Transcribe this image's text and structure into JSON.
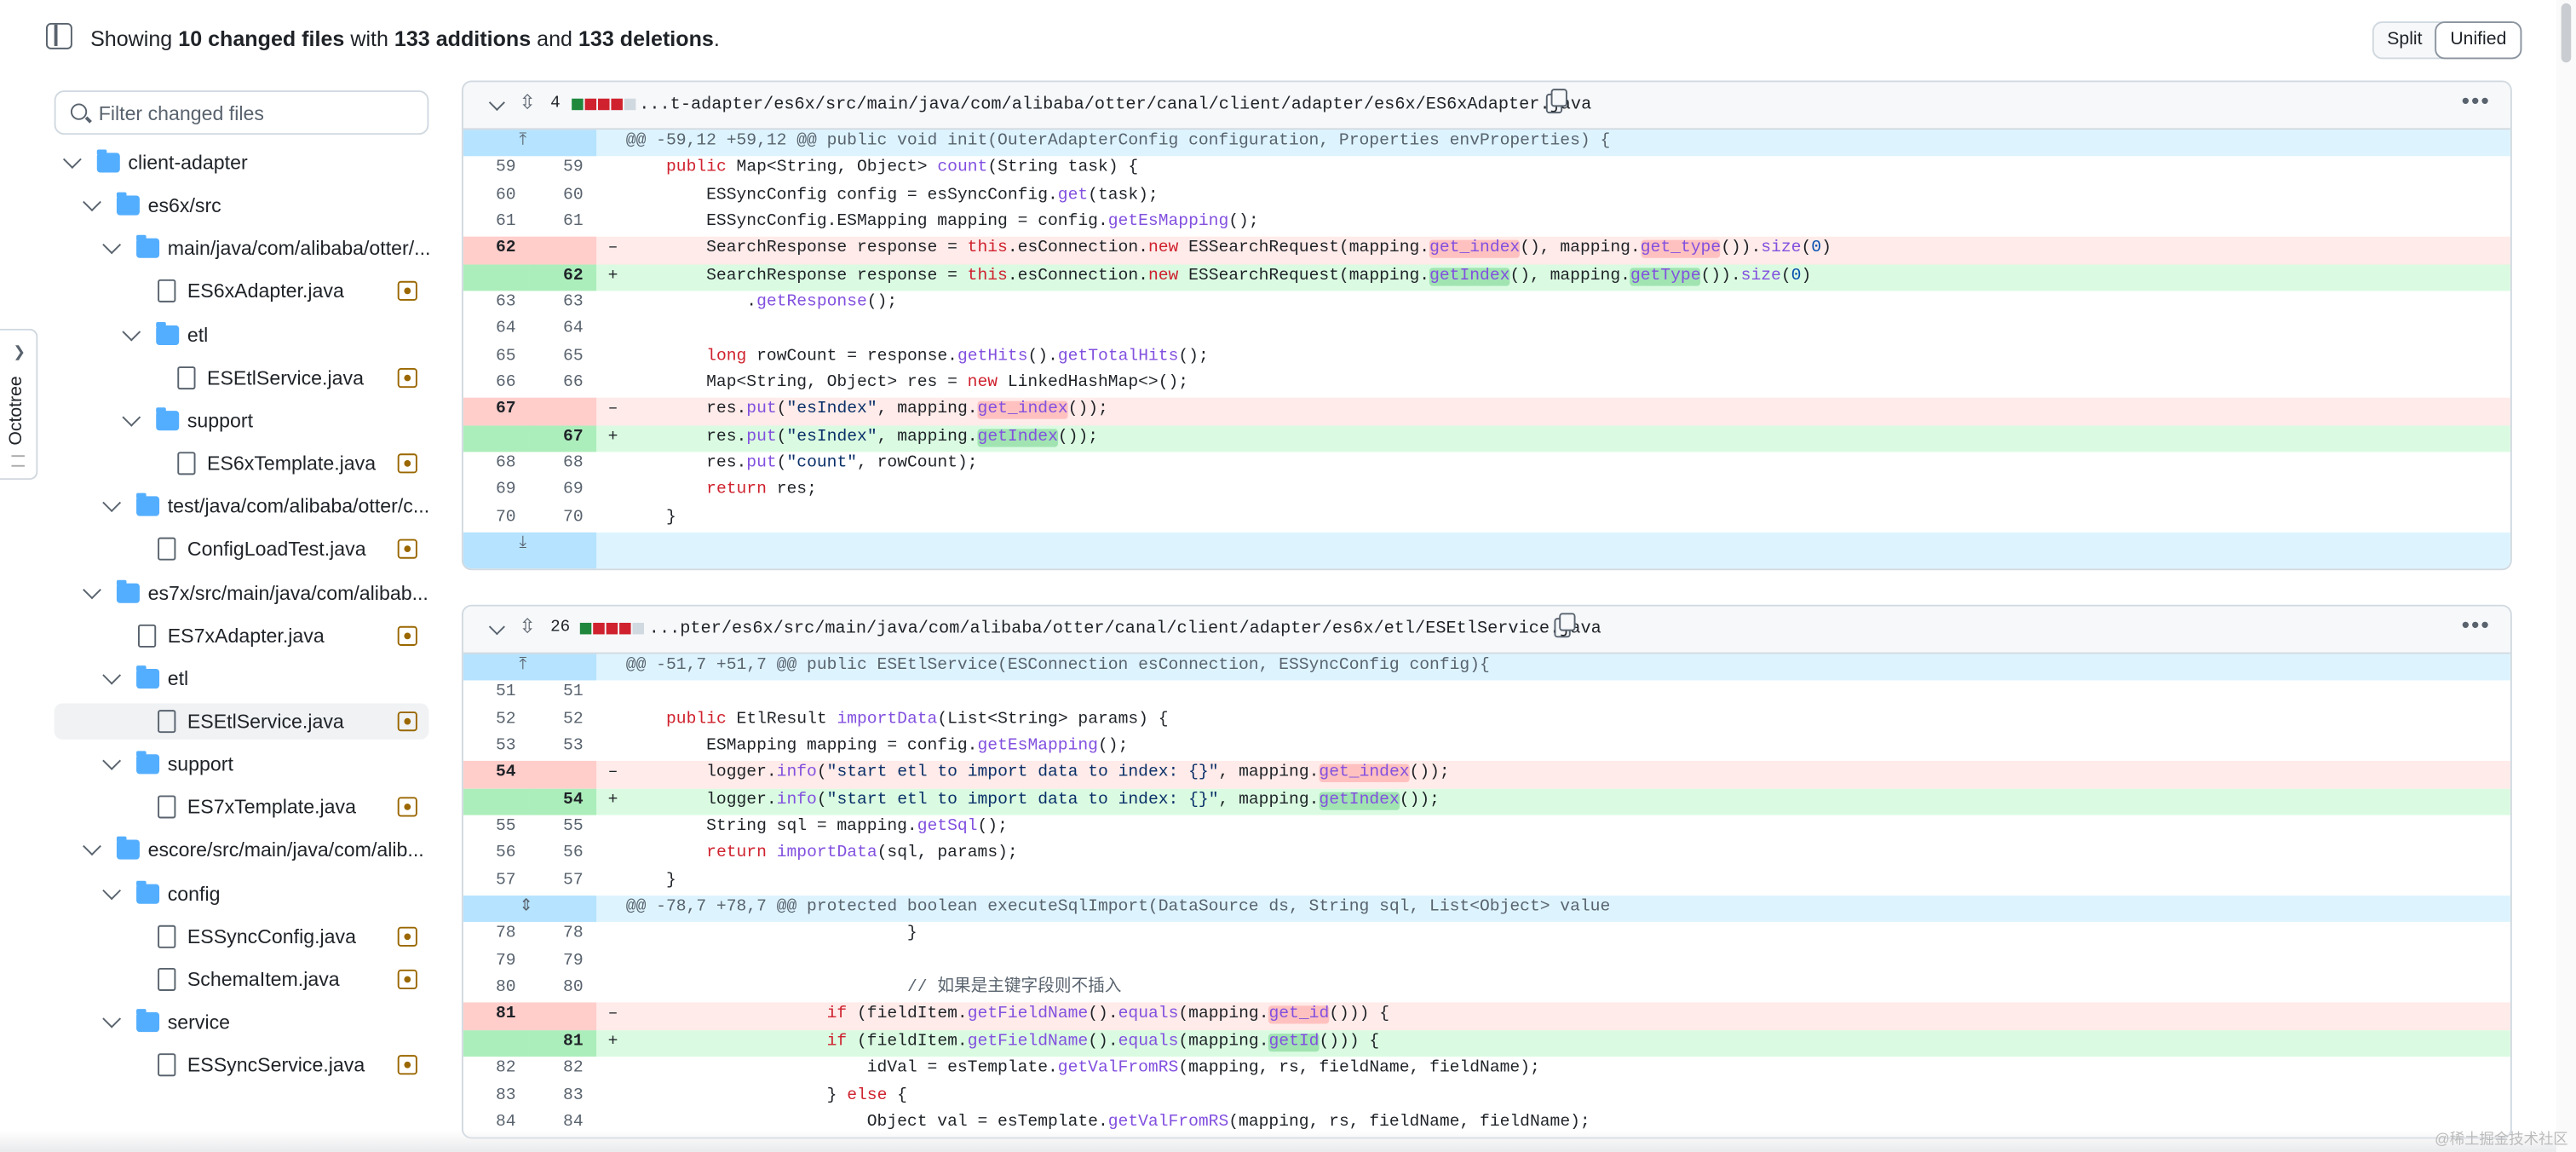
{
  "header": {
    "showing": "Showing",
    "files_count": "10 changed files",
    "with": "with",
    "additions": "133 additions",
    "and": "and",
    "deletions": "133 deletions",
    "period": ".",
    "view_split": "Split",
    "view_unified": "Unified"
  },
  "sidebar": {
    "filter_placeholder": "Filter changed files",
    "items": [
      {
        "type": "folder",
        "label": "client-adapter",
        "depth": 0
      },
      {
        "type": "folder",
        "label": "es6x/src",
        "depth": 1
      },
      {
        "type": "folder",
        "label": "main/java/com/alibaba/otter/...",
        "depth": 2
      },
      {
        "type": "file",
        "label": "ES6xAdapter.java",
        "depth": 3
      },
      {
        "type": "folder",
        "label": "etl",
        "depth": 3
      },
      {
        "type": "file",
        "label": "ESEtlService.java",
        "depth": 4
      },
      {
        "type": "folder",
        "label": "support",
        "depth": 3
      },
      {
        "type": "file",
        "label": "ES6xTemplate.java",
        "depth": 4
      },
      {
        "type": "folder",
        "label": "test/java/com/alibaba/otter/c...",
        "depth": 2
      },
      {
        "type": "file",
        "label": "ConfigLoadTest.java",
        "depth": 3
      },
      {
        "type": "folder",
        "label": "es7x/src/main/java/com/alibab...",
        "depth": 1
      },
      {
        "type": "file",
        "label": "ES7xAdapter.java",
        "depth": 2
      },
      {
        "type": "folder",
        "label": "etl",
        "depth": 2
      },
      {
        "type": "file",
        "label": "ESEtlService.java",
        "depth": 3,
        "selected": true
      },
      {
        "type": "folder",
        "label": "support",
        "depth": 2
      },
      {
        "type": "file",
        "label": "ES7xTemplate.java",
        "depth": 3
      },
      {
        "type": "folder",
        "label": "escore/src/main/java/com/alib...",
        "depth": 1
      },
      {
        "type": "folder",
        "label": "config",
        "depth": 2
      },
      {
        "type": "file",
        "label": "ESSyncConfig.java",
        "depth": 3
      },
      {
        "type": "file",
        "label": "SchemaItem.java",
        "depth": 3
      },
      {
        "type": "folder",
        "label": "service",
        "depth": 2
      },
      {
        "type": "file",
        "label": "ESSyncService.java",
        "depth": 3
      }
    ]
  },
  "octotree": {
    "label": "Octotree"
  },
  "files": [
    {
      "count": "4",
      "bars": [
        "g",
        "r",
        "r",
        "r",
        "n"
      ],
      "path": "...t-adapter/es6x/src/main/java/com/alibaba/otter/canal/client/adapter/es6x/ES6xAdapter.java",
      "lines": [
        {
          "kind": "hunk",
          "text": "@@ -59,12 +59,12 @@ public void init(OuterAdapterConfig configuration, Properties envProperties) {",
          "expand": "up"
        },
        {
          "kind": "ctx",
          "o": "59",
          "n": "59",
          "html": "    <span class=\"k\">public</span> Map&lt;String, Object&gt; <span class=\"f\">count</span>(String task) {"
        },
        {
          "kind": "ctx",
          "o": "60",
          "n": "60",
          "html": "        ESSyncConfig config = esSyncConfig.<span class=\"f\">get</span>(task);"
        },
        {
          "kind": "ctx",
          "o": "61",
          "n": "61",
          "html": "        ESSyncConfig.ESMapping mapping = config.<span class=\"f\">getEsMapping</span>();"
        },
        {
          "kind": "del",
          "o": "62",
          "n": "",
          "html": "        SearchResponse response = <span class=\"k\">this</span>.esConnection.<span class=\"k\">new</span> ESSearchRequest(mapping.<span class=\"f dx\">get_index</span>(), mapping.<span class=\"f dx\">get_type</span>()).<span class=\"f\">size</span>(<span class=\"num\">0</span>)"
        },
        {
          "kind": "add",
          "o": "",
          "n": "62",
          "html": "        SearchResponse response = <span class=\"k\">this</span>.esConnection.<span class=\"k\">new</span> ESSearchRequest(mapping.<span class=\"f ax\">getIndex</span>(), mapping.<span class=\"f ax\">getType</span>()).<span class=\"f\">size</span>(<span class=\"num\">0</span>)"
        },
        {
          "kind": "ctx",
          "o": "63",
          "n": "63",
          "html": "            .<span class=\"f\">getResponse</span>();"
        },
        {
          "kind": "ctx",
          "o": "64",
          "n": "64",
          "html": ""
        },
        {
          "kind": "ctx",
          "o": "65",
          "n": "65",
          "html": "        <span class=\"k\">long</span> rowCount = response.<span class=\"f\">getHits</span>().<span class=\"f\">getTotalHits</span>();"
        },
        {
          "kind": "ctx",
          "o": "66",
          "n": "66",
          "html": "        Map&lt;String, Object&gt; res = <span class=\"k\">new</span> LinkedHashMap&lt;&gt;();"
        },
        {
          "kind": "del",
          "o": "67",
          "n": "",
          "html": "        res.<span class=\"f\">put</span>(<span class=\"s\">\"esIndex\"</span>, mapping.<span class=\"f dx\">get_index</span>());"
        },
        {
          "kind": "add",
          "o": "",
          "n": "67",
          "html": "        res.<span class=\"f\">put</span>(<span class=\"s\">\"esIndex\"</span>, mapping.<span class=\"f ax\">getIndex</span>());"
        },
        {
          "kind": "ctx",
          "o": "68",
          "n": "68",
          "html": "        res.<span class=\"f\">put</span>(<span class=\"s\">\"count\"</span>, rowCount);"
        },
        {
          "kind": "ctx",
          "o": "69",
          "n": "69",
          "html": "        <span class=\"k\">return</span> res;"
        },
        {
          "kind": "ctx",
          "o": "70",
          "n": "70",
          "html": "    }"
        },
        {
          "kind": "hunk",
          "text": "",
          "expand": "down",
          "tall": true
        }
      ]
    },
    {
      "count": "26",
      "bars": [
        "g",
        "r",
        "r",
        "r",
        "n"
      ],
      "path": "...pter/es6x/src/main/java/com/alibaba/otter/canal/client/adapter/es6x/etl/ESEtlService.java",
      "lines": [
        {
          "kind": "hunk",
          "text": "@@ -51,7 +51,7 @@ public ESEtlService(ESConnection esConnection, ESSyncConfig config){",
          "expand": "up"
        },
        {
          "kind": "ctx",
          "o": "51",
          "n": "51",
          "html": ""
        },
        {
          "kind": "ctx",
          "o": "52",
          "n": "52",
          "html": "    <span class=\"k\">public</span> EtlResult <span class=\"f\">importData</span>(List&lt;String&gt; params) {"
        },
        {
          "kind": "ctx",
          "o": "53",
          "n": "53",
          "html": "        ESMapping mapping = config.<span class=\"f\">getEsMapping</span>();"
        },
        {
          "kind": "del",
          "o": "54",
          "n": "",
          "html": "        logger.<span class=\"f\">info</span>(<span class=\"s\">\"start etl to import data to index: {}\"</span>, mapping.<span class=\"f dx\">get_index</span>());"
        },
        {
          "kind": "add",
          "o": "",
          "n": "54",
          "html": "        logger.<span class=\"f\">info</span>(<span class=\"s\">\"start etl to import data to index: {}\"</span>, mapping.<span class=\"f ax\">getIndex</span>());"
        },
        {
          "kind": "ctx",
          "o": "55",
          "n": "55",
          "html": "        String sql = mapping.<span class=\"f\">getSql</span>();"
        },
        {
          "kind": "ctx",
          "o": "56",
          "n": "56",
          "html": "        <span class=\"k\">return</span> <span class=\"f\">importData</span>(sql, params);"
        },
        {
          "kind": "ctx",
          "o": "57",
          "n": "57",
          "html": "    }"
        },
        {
          "kind": "hunk",
          "text": "@@ -78,7 +78,7 @@ protected boolean executeSqlImport(DataSource ds, String sql, List<Object> value",
          "expand": "both"
        },
        {
          "kind": "ctx",
          "o": "78",
          "n": "78",
          "html": "                            }"
        },
        {
          "kind": "ctx",
          "o": "79",
          "n": "79",
          "html": ""
        },
        {
          "kind": "ctx",
          "o": "80",
          "n": "80",
          "html": "                            <span class=\"cm\">// 如果是主键字段则不插入</span>"
        },
        {
          "kind": "del",
          "o": "81",
          "n": "",
          "html": "                    <span class=\"k\">if</span> (fieldItem.<span class=\"f\">getFieldName</span>().<span class=\"f\">equals</span>(mapping.<span class=\"f dx\">get_id</span>())) {"
        },
        {
          "kind": "add",
          "o": "",
          "n": "81",
          "html": "                    <span class=\"k\">if</span> (fieldItem.<span class=\"f\">getFieldName</span>().<span class=\"f\">equals</span>(mapping.<span class=\"f ax\">getId</span>())) {"
        },
        {
          "kind": "ctx",
          "o": "82",
          "n": "82",
          "html": "                        idVal = esTemplate.<span class=\"f\">getValFromRS</span>(mapping, rs, fieldName, fieldName);"
        },
        {
          "kind": "ctx",
          "o": "83",
          "n": "83",
          "html": "                    } <span class=\"k\">else</span> {"
        },
        {
          "kind": "ctx",
          "o": "84",
          "n": "84",
          "html": "                        Object val = esTemplate.<span class=\"f\">getValFromRS</span>(mapping, rs, fieldName, fieldName);"
        }
      ]
    }
  ],
  "watermark": "@稀土掘金技术社区"
}
